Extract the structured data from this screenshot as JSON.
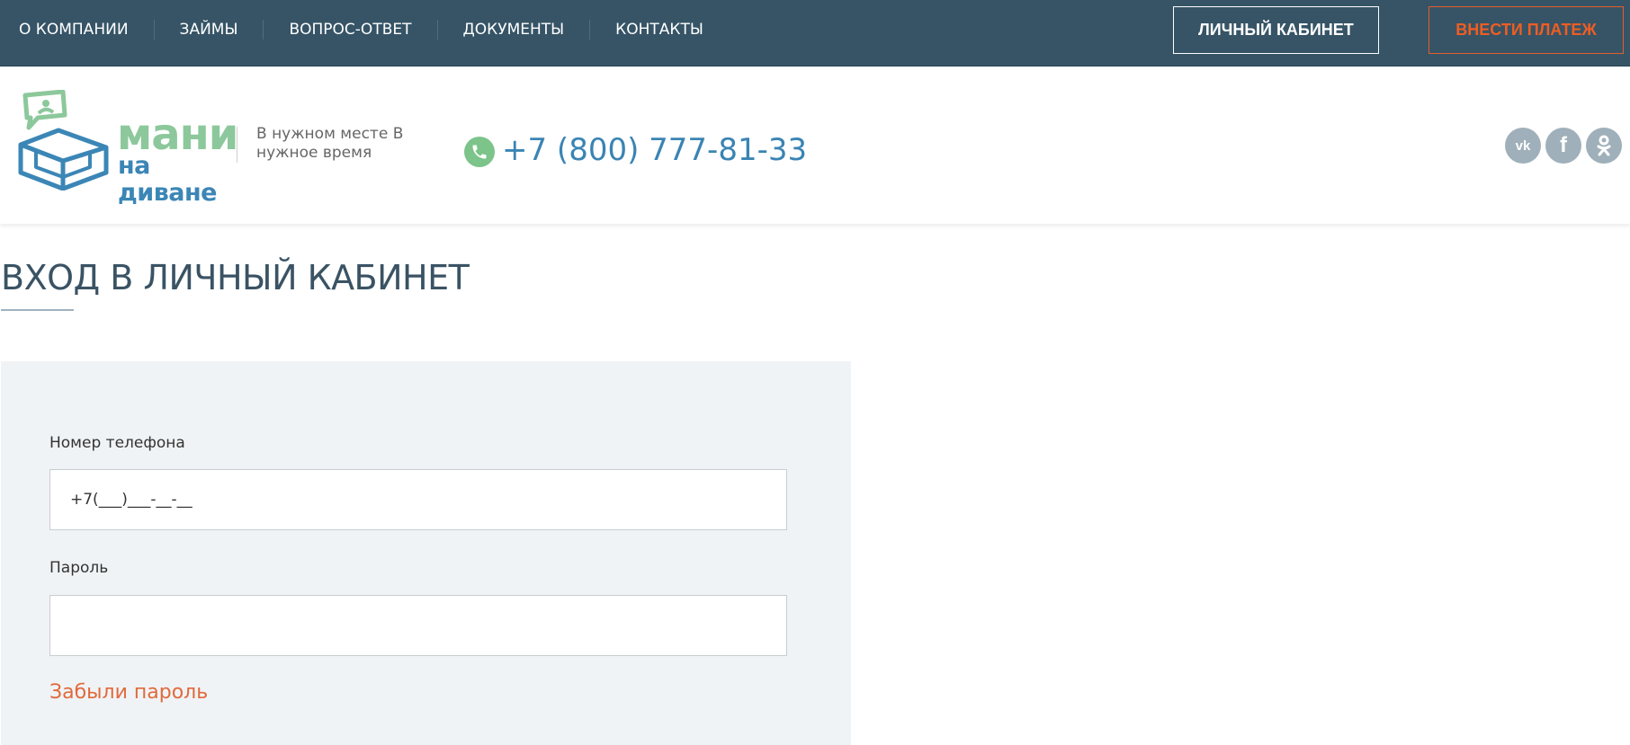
{
  "topnav": {
    "items": [
      {
        "label": "О КОМПАНИИ"
      },
      {
        "label": "ЗАЙМЫ"
      },
      {
        "label": "ВОПРОС-ОТВЕТ"
      },
      {
        "label": "ДОКУМЕНТЫ"
      },
      {
        "label": "КОНТАКТЫ"
      }
    ],
    "cabinet_button": "ЛИЧНЫЙ КАБИНЕТ",
    "pay_button": "ВНЕСТИ ПЛАТЕЖ"
  },
  "header": {
    "logo_top": "мани",
    "logo_bottom": "на диване",
    "tagline": "В нужном месте В нужное время",
    "phone": "+7 (800) 777-81-33",
    "social": [
      {
        "icon": "vk-icon"
      },
      {
        "icon": "facebook-icon"
      },
      {
        "icon": "odnoklassniki-icon"
      }
    ]
  },
  "main": {
    "title": "ВХОД В ЛИЧНЫЙ КАБИНЕТ"
  },
  "form": {
    "phone_label": "Номер телефона",
    "phone_value": "+7(___)___-__-__",
    "password_label": "Пароль",
    "password_value": "",
    "forgot_link": "Забыли пароль"
  },
  "colors": {
    "topbar_bg": "#365466",
    "accent_orange": "#ef5d23",
    "logo_green": "#8cc89b",
    "logo_blue": "#3b86b6",
    "phone_blue": "#3a84b4",
    "form_bg": "#f0f3f6"
  }
}
